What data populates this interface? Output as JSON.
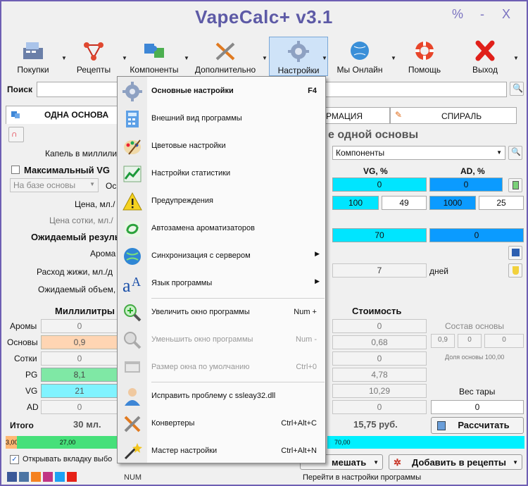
{
  "window": {
    "title": "VapeCalc+ v3.1",
    "btn_percent": "%",
    "btn_min": "-",
    "btn_close": "X"
  },
  "toolbar": {
    "items": [
      "Покупки",
      "Рецепты",
      "Компоненты",
      "Дополнительно",
      "Настройки",
      "Мы Онлайн",
      "Помощь",
      "Выход"
    ]
  },
  "search": {
    "label": "Поиск",
    "value": ""
  },
  "tabs": {
    "one_base": "ОДНА ОСНОВА",
    "info": "РМАЦИЯ",
    "spiral": "СПИРАЛЬ"
  },
  "left": {
    "drop_label": "Капель в миллили",
    "max_vg": "Максимальный VG",
    "base_select": "На базе основы",
    "os": "Ос",
    "price": "Цена, мл./",
    "price100": "Цена сотки, мл./",
    "expected": "Ожидаемый резуль",
    "aroma": "Арома",
    "consumption": "Расход жижи, мл./д",
    "expected_vol": "Ожидаемый объем,",
    "ml_header": "Миллилитры",
    "rows": [
      {
        "label": "Аромы",
        "value": "0"
      },
      {
        "label": "Основы",
        "value": "0,9"
      },
      {
        "label": "Сотки",
        "value": "0"
      },
      {
        "label": "PG",
        "value": "8,1"
      },
      {
        "label": "VG",
        "value": "21"
      },
      {
        "label": "AD",
        "value": "0"
      }
    ],
    "total_label": "Итого",
    "total_value": "30 мл.",
    "open_tab": "Открывать вкладку выбо"
  },
  "right": {
    "heading": "е одной основы",
    "components": "Компоненты",
    "vg_header": "VG, %",
    "ad_header": "AD, %",
    "vg_val": "0",
    "ad_val": "0",
    "vg_left": "100",
    "vg_right": "49",
    "ad_left": "1000",
    "ad_right": "25",
    "vg_big": "70",
    "ad_big": "0",
    "days_val": "7",
    "days_label": "дней",
    "cost_header": "Стоимость",
    "cost": [
      "0",
      "0,68",
      "0",
      "4,78",
      "10,29",
      "0"
    ],
    "cost_total": "15,75 руб.",
    "base_comp_label": "Состав основы",
    "base_comp": [
      "0,9",
      "0",
      "0"
    ],
    "base_share": "Доля основы 100,00",
    "tare_label": "Вес тары",
    "tare_val": "0",
    "calc_btn": "Рассчитать",
    "mix_btn": "мешать",
    "add_btn": "Добавить в рецепты"
  },
  "bar": {
    "seg1": "3,00",
    "seg2": "27,00",
    "seg3": "70,00"
  },
  "status": {
    "num": "NUM",
    "hint": "Перейти в настройки программы"
  },
  "menu": {
    "items": [
      {
        "label": "Основные настройки",
        "shortcut": "F4",
        "bold": true
      },
      {
        "label": "Внешний вид программы",
        "shortcut": ""
      },
      {
        "label": "Цветовые настройки",
        "shortcut": ""
      },
      {
        "label": "Настройки статистики",
        "shortcut": ""
      },
      {
        "label": "Предупреждения",
        "shortcut": ""
      },
      {
        "label": "Автозамена ароматизаторов",
        "shortcut": ""
      },
      {
        "label": "Синхронизация с сервером",
        "shortcut": "▶"
      },
      {
        "label": "Язык программы",
        "shortcut": "▶"
      },
      {
        "label": "Увеличить окно программы",
        "shortcut": "Num +"
      },
      {
        "label": "Уменьшить окно программы",
        "shortcut": "Num -"
      },
      {
        "label": "Размер окна по умолчанию",
        "shortcut": "Ctrl+0"
      },
      {
        "label": "Исправить проблему с ssleay32.dll",
        "shortcut": ""
      },
      {
        "label": "Конвертеры",
        "shortcut": "Ctrl+Alt+C"
      },
      {
        "label": "Мастер настройки",
        "shortcut": "Ctrl+Alt+N"
      }
    ]
  }
}
